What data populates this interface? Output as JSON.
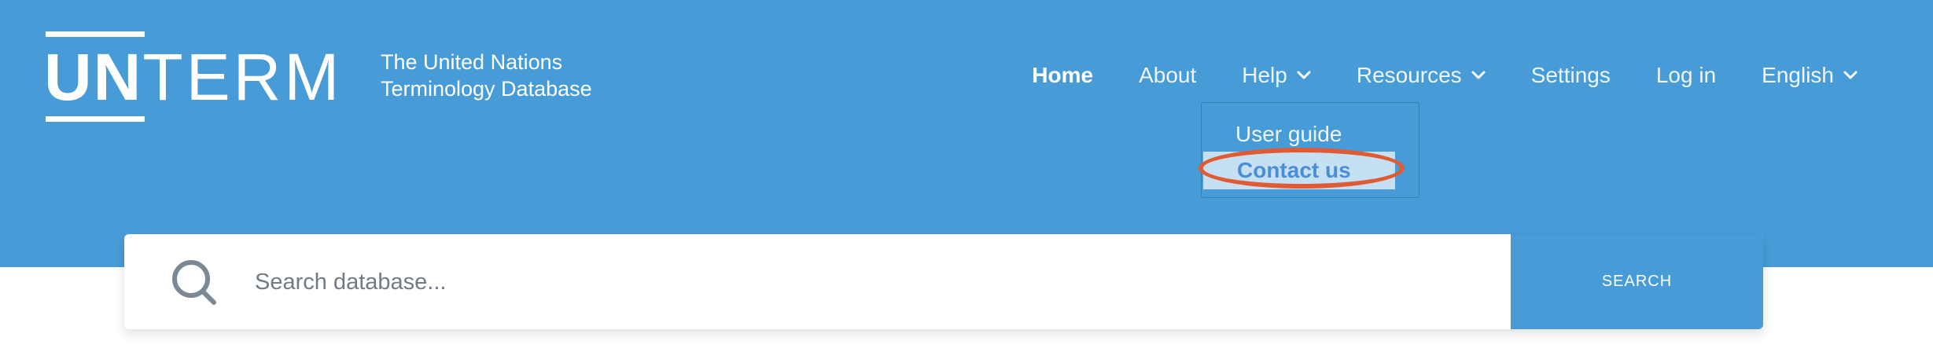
{
  "logo": {
    "word_bold": "UN",
    "word_light": "TERM",
    "tagline_line1": "The United Nations",
    "tagline_line2": "Terminology Database"
  },
  "nav": {
    "home": "Home",
    "about": "About",
    "help": "Help",
    "resources": "Resources",
    "settings": "Settings",
    "login": "Log in",
    "language": "English"
  },
  "help_menu": {
    "items": [
      {
        "label": "User guide"
      },
      {
        "label": "Contact us",
        "highlighted": true
      }
    ]
  },
  "search": {
    "placeholder": "Search database...",
    "value": "",
    "button_label": "SEARCH"
  },
  "colors": {
    "header_bg": "#479cd8",
    "highlight_bg": "#c5e0f3",
    "annotation": "#e05a33"
  },
  "icons": [
    "chevron-down-icon",
    "search-icon"
  ]
}
